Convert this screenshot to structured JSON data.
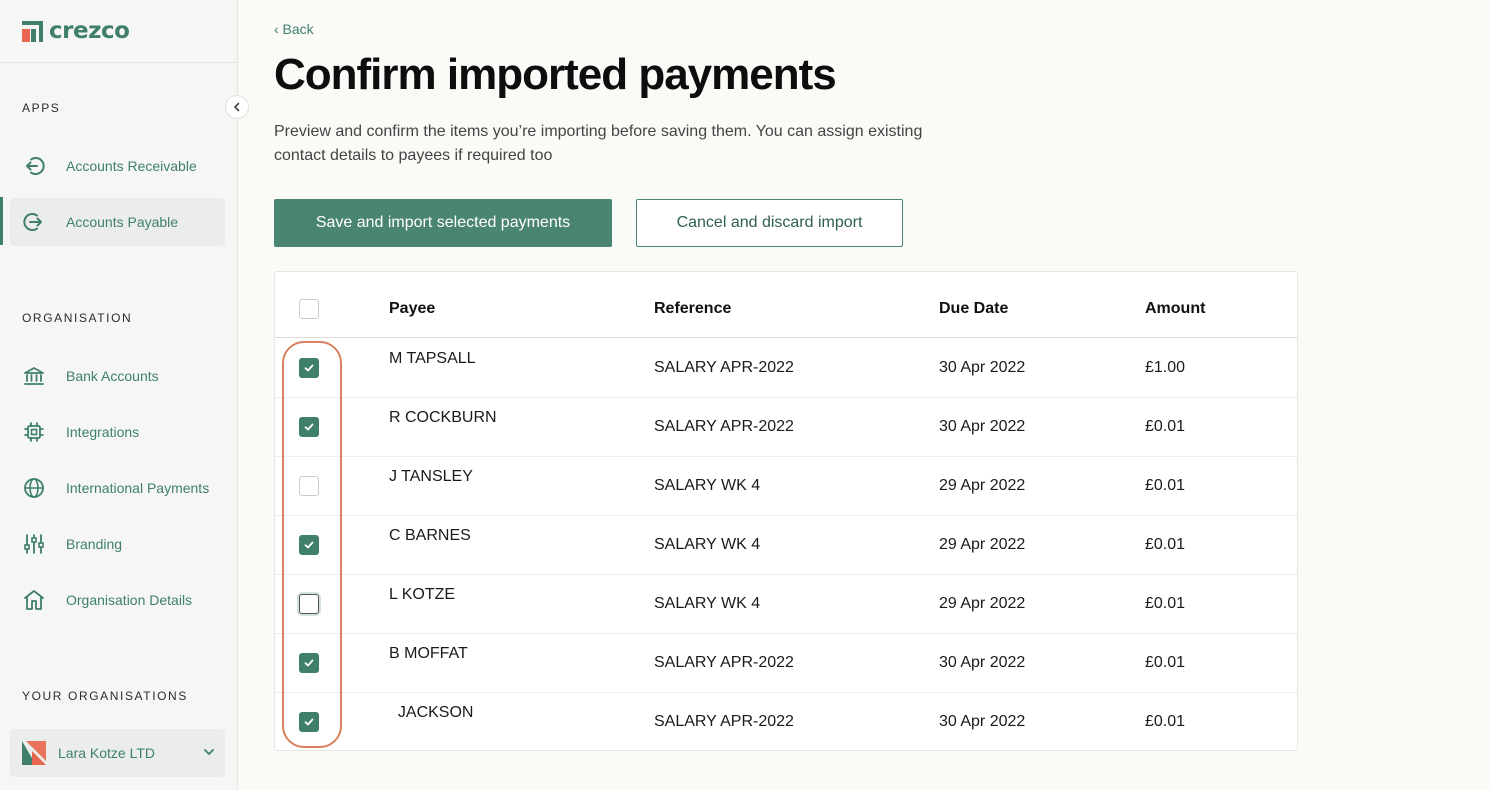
{
  "brand": {
    "name": "crezco",
    "accent": "#3f7f6b"
  },
  "sidebar": {
    "apps_label": "APPS",
    "apps": [
      {
        "label": "Accounts Receivable",
        "icon": "arrow-in-circle-icon",
        "active": false
      },
      {
        "label": "Accounts Payable",
        "icon": "arrow-out-circle-icon",
        "active": true
      }
    ],
    "organisation_label": "ORGANISATION",
    "organisation": [
      {
        "label": "Bank Accounts",
        "icon": "bank-icon"
      },
      {
        "label": "Integrations",
        "icon": "chip-icon"
      },
      {
        "label": "International Payments",
        "icon": "globe-icon"
      },
      {
        "label": "Branding",
        "icon": "sliders-icon"
      },
      {
        "label": "Organisation Details",
        "icon": "building-icon"
      }
    ],
    "your_orgs_label": "YOUR ORGANISATIONS",
    "current_org": "Lara Kotze LTD"
  },
  "main": {
    "back": "‹ Back",
    "title": "Confirm imported payments",
    "description": "Preview and confirm the items you’re importing before saving them. You can assign existing contact details to payees if required too",
    "save_button": "Save and import selected payments",
    "cancel_button": "Cancel and discard import"
  },
  "table": {
    "headers": {
      "payee": "Payee",
      "reference": "Reference",
      "due_date": "Due Date",
      "amount": "Amount"
    },
    "rows": [
      {
        "payee": "M TAPSALL",
        "reference": "SALARY APR-2022",
        "due_date": "30 Apr 2022",
        "amount": "£1.00",
        "checked": true
      },
      {
        "payee": "R COCKBURN",
        "reference": "SALARY APR-2022",
        "due_date": "30 Apr 2022",
        "amount": "£0.01",
        "checked": true
      },
      {
        "payee": "J TANSLEY",
        "reference": "SALARY WK 4",
        "due_date": "29 Apr 2022",
        "amount": "£0.01",
        "checked": false
      },
      {
        "payee": "C BARNES",
        "reference": "SALARY WK 4",
        "due_date": "29 Apr 2022",
        "amount": "£0.01",
        "checked": true
      },
      {
        "payee": "L KOTZE",
        "reference": "SALARY WK 4",
        "due_date": "29 Apr 2022",
        "amount": "£0.01",
        "checked": false
      },
      {
        "payee": "B MOFFAT",
        "reference": "SALARY APR-2022",
        "due_date": "30 Apr 2022",
        "amount": "£0.01",
        "checked": true
      },
      {
        "payee": "  JACKSON",
        "reference": "SALARY APR-2022",
        "due_date": "30 Apr 2022",
        "amount": "£0.01",
        "checked": true
      }
    ]
  }
}
